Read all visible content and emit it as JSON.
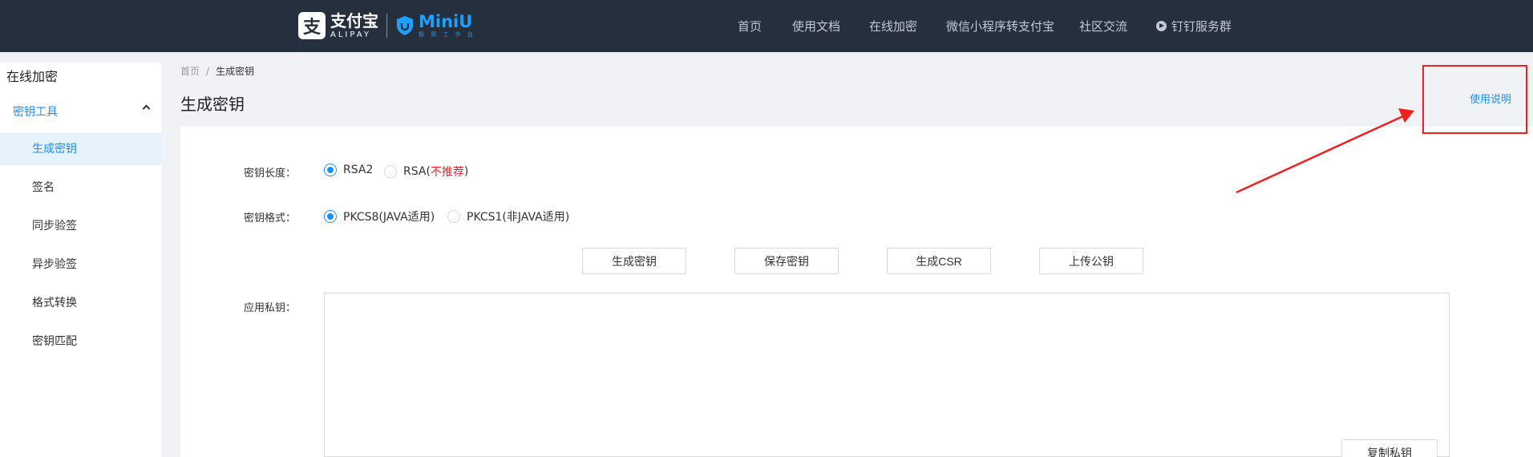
{
  "brand": {
    "alipay_cn": "支付宝",
    "alipay_en": "ALIPAY",
    "miniu_name": "MiniU",
    "miniu_sub": "极 简 工 作 台",
    "alipay_icon": "alipay-logo-icon",
    "miniu_icon": "miniu-shield-icon"
  },
  "nav": {
    "items": [
      {
        "label": "首页"
      },
      {
        "label": "使用文档"
      },
      {
        "label": "在线加密"
      },
      {
        "label": "微信小程序转支付宝"
      },
      {
        "label": "社区交流"
      },
      {
        "label": "钉钉服务群",
        "icon": "dingtalk-icon"
      }
    ]
  },
  "sidebar": {
    "title": "在线加密",
    "group_label": "密钥工具",
    "items": [
      {
        "label": "生成密钥",
        "active": true
      },
      {
        "label": "签名"
      },
      {
        "label": "同步验签"
      },
      {
        "label": "异步验签"
      },
      {
        "label": "格式转换"
      },
      {
        "label": "密钥匹配"
      }
    ]
  },
  "breadcrumb": {
    "home": "首页",
    "separator": "/",
    "current": "生成密钥"
  },
  "page": {
    "title": "生成密钥",
    "help_link": "使用说明"
  },
  "form": {
    "key_length_label": "密钥长度：",
    "key_length_options": [
      {
        "label": "RSA2",
        "checked": true
      },
      {
        "label": "RSA(",
        "warn": "不推荐",
        "suffix": ")",
        "checked": false
      }
    ],
    "key_format_label": "密钥格式：",
    "key_format_options": [
      {
        "label": "PKCS8(JAVA适用)",
        "checked": true
      },
      {
        "label": "PKCS1(非JAVA适用)",
        "checked": false
      }
    ],
    "buttons": {
      "generate": "生成密钥",
      "save": "保存密钥",
      "csr": "生成CSR",
      "upload": "上传公钥"
    },
    "private_key_label": "应用私钥：",
    "private_key_value": "",
    "copy_button": "复制私钥"
  },
  "colors": {
    "topbar": "#262f3e",
    "accent": "#1890ff",
    "annotation": "#f0201e",
    "warning": "#f5222d"
  }
}
